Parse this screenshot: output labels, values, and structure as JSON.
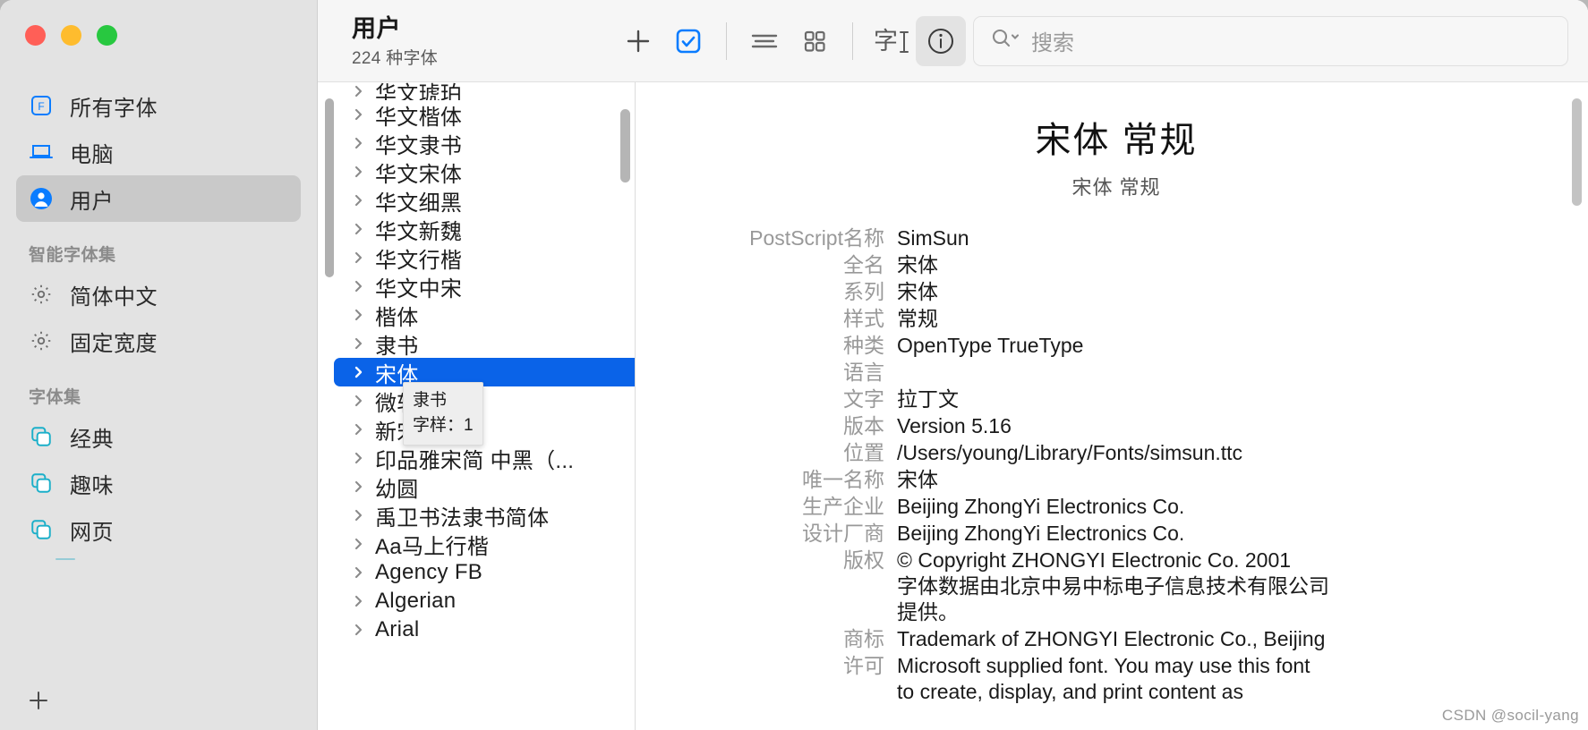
{
  "window": {
    "traffic_lights": [
      "close",
      "minimize",
      "zoom"
    ],
    "colors": {
      "accent_blue": "#0a63e8",
      "sidebar_bg": "#e3e3e3",
      "selection_blue": "#0a63e8",
      "teal": "#1bafc9",
      "green": "#28c840",
      "yellow": "#febc2e",
      "red": "#ff5f57"
    }
  },
  "toolbar": {
    "title": "用户",
    "subtitle": "224 种字体",
    "add_label": "+",
    "buttons": [
      {
        "name": "add",
        "icon": "plus-icon"
      },
      {
        "name": "validate",
        "icon": "checkbox-checked-icon"
      },
      {
        "name": "list-view",
        "icon": "list-view-icon"
      },
      {
        "name": "grid-view",
        "icon": "grid-view-icon"
      },
      {
        "name": "sample-text",
        "icon": "text-cursor-icon",
        "glyph": "字"
      },
      {
        "name": "info",
        "icon": "info-circle-icon",
        "active": true
      }
    ],
    "search": {
      "placeholder": "搜索",
      "value": "",
      "icon": "search-chevron-icon"
    }
  },
  "sidebar": {
    "items": [
      {
        "label": "所有字体",
        "icon": "font-book-icon",
        "selected": false
      },
      {
        "label": "电脑",
        "icon": "laptop-icon",
        "selected": false
      },
      {
        "label": "用户",
        "icon": "person-circle-icon",
        "selected": true
      }
    ],
    "sections": [
      {
        "title": "智能字体集",
        "items": [
          {
            "label": "简体中文",
            "icon": "gear-icon"
          },
          {
            "label": "固定宽度",
            "icon": "gear-icon"
          }
        ]
      },
      {
        "title": "字体集",
        "items": [
          {
            "label": "经典",
            "icon": "collection-icon"
          },
          {
            "label": "趣味",
            "icon": "collection-icon"
          },
          {
            "label": "网页",
            "icon": "collection-icon"
          }
        ]
      }
    ],
    "add_button": "+"
  },
  "font_list": {
    "items": [
      {
        "name": "华文琥珀",
        "selected": false,
        "clipped": true
      },
      {
        "name": "华文楷体",
        "selected": false
      },
      {
        "name": "华文隶书",
        "selected": false
      },
      {
        "name": "华文宋体",
        "selected": false
      },
      {
        "name": "华文细黑",
        "selected": false
      },
      {
        "name": "华文新魏",
        "selected": false
      },
      {
        "name": "华文行楷",
        "selected": false
      },
      {
        "name": "华文中宋",
        "selected": false
      },
      {
        "name": "楷体",
        "selected": false
      },
      {
        "name": "隶书",
        "selected": false
      },
      {
        "name": "宋体",
        "selected": true
      },
      {
        "name": "微软雅黑",
        "selected": false
      },
      {
        "name": "新宋体",
        "selected": false
      },
      {
        "name": "印品雅宋简 中黑（...",
        "selected": false
      },
      {
        "name": "幼圆",
        "selected": false
      },
      {
        "name": "禹卫书法隶书简体",
        "selected": false
      },
      {
        "name": "Aa马上行楷",
        "selected": false
      },
      {
        "name": "Agency FB",
        "selected": false
      },
      {
        "name": "Algerian",
        "selected": false
      },
      {
        "name": "Arial",
        "selected": false
      }
    ]
  },
  "tooltip": {
    "name": "隶书",
    "typefaces_label": "字样：1"
  },
  "detail": {
    "title": "宋体 常规",
    "subtitle": "宋体 常规",
    "rows": [
      {
        "key": "PostScript名称",
        "value": "SimSun"
      },
      {
        "key": "全名",
        "value": "宋体"
      },
      {
        "key": "系列",
        "value": "宋体"
      },
      {
        "key": "样式",
        "value": "常规"
      },
      {
        "key": "种类",
        "value": "OpenType TrueType"
      },
      {
        "key": "语言",
        "value": ""
      },
      {
        "key": "文字",
        "value": "拉丁文"
      },
      {
        "key": "版本",
        "value": "Version 5.16"
      },
      {
        "key": "位置",
        "value": "/Users/young/Library/Fonts/simsun.ttc"
      },
      {
        "key": "唯一名称",
        "value": "宋体"
      },
      {
        "key": "生产企业",
        "value": "Beijing ZhongYi Electronics Co."
      },
      {
        "key": "设计厂商",
        "value": "Beijing ZhongYi Electronics Co."
      },
      {
        "key": "版权",
        "value": "© Copyright ZHONGYI Electronic Co. 2001\n字体数据由北京中易中标电子信息技术有限公司\n提供。"
      },
      {
        "key": "商标",
        "value": "Trademark of ZHONGYI Electronic Co., Beijing"
      },
      {
        "key": "许可",
        "value": "Microsoft supplied font. You may use this font\nto create, display, and print content as"
      }
    ]
  },
  "watermark": "CSDN @socil-yang"
}
